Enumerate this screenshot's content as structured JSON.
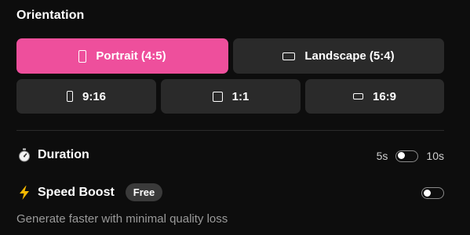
{
  "orientation": {
    "title": "Orientation",
    "options": [
      {
        "label": "Portrait (4:5)",
        "icon": "portrait-rect-icon",
        "selected": true
      },
      {
        "label": "Landscape (5:4)",
        "icon": "landscape-rect-icon",
        "selected": false
      },
      {
        "label": "9:16",
        "icon": "tall-rect-icon",
        "selected": false
      },
      {
        "label": "1:1",
        "icon": "square-icon",
        "selected": false
      },
      {
        "label": "16:9",
        "icon": "wide-rect-icon",
        "selected": false
      }
    ],
    "accent_color": "#ee4f9c"
  },
  "duration": {
    "label": "Duration",
    "icon": "stopwatch-icon",
    "min_label": "5s",
    "max_label": "10s",
    "toggle_on": false
  },
  "speed_boost": {
    "label": "Speed Boost",
    "icon": "lightning-icon",
    "badge": "Free",
    "toggle_on": false,
    "description": "Generate faster with minimal quality loss"
  }
}
